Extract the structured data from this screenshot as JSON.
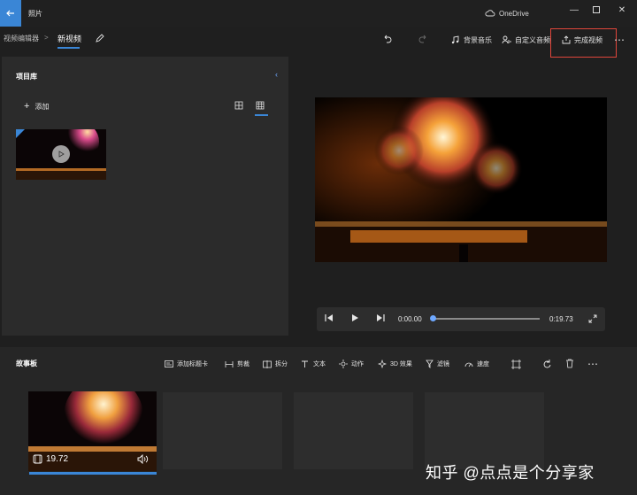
{
  "app": {
    "title": "照片",
    "cloud_label": "OneDrive"
  },
  "breadcrumb": {
    "root": "视频编辑器",
    "separator": ">",
    "current": "新视频"
  },
  "toolbar": {
    "background_music": "背景音乐",
    "custom_audio": "自定义音频",
    "finish_video": "完成视频"
  },
  "library": {
    "title": "项目库",
    "add_label": "添加"
  },
  "player": {
    "current_time": "0:00.00",
    "total_time": "0:19.73",
    "progress": 0
  },
  "storyboard": {
    "title": "故事板",
    "tools": [
      "添加标题卡",
      "剪裁",
      "拆分",
      "文本",
      "动作",
      "3D 效果",
      "滤镜",
      "速度"
    ],
    "clip_duration": "19.72"
  },
  "watermark": "知乎 @点点是个分享家",
  "colors": {
    "accent": "#3a86d6",
    "highlight": "#e0463b",
    "background": "#1f1f1f"
  }
}
